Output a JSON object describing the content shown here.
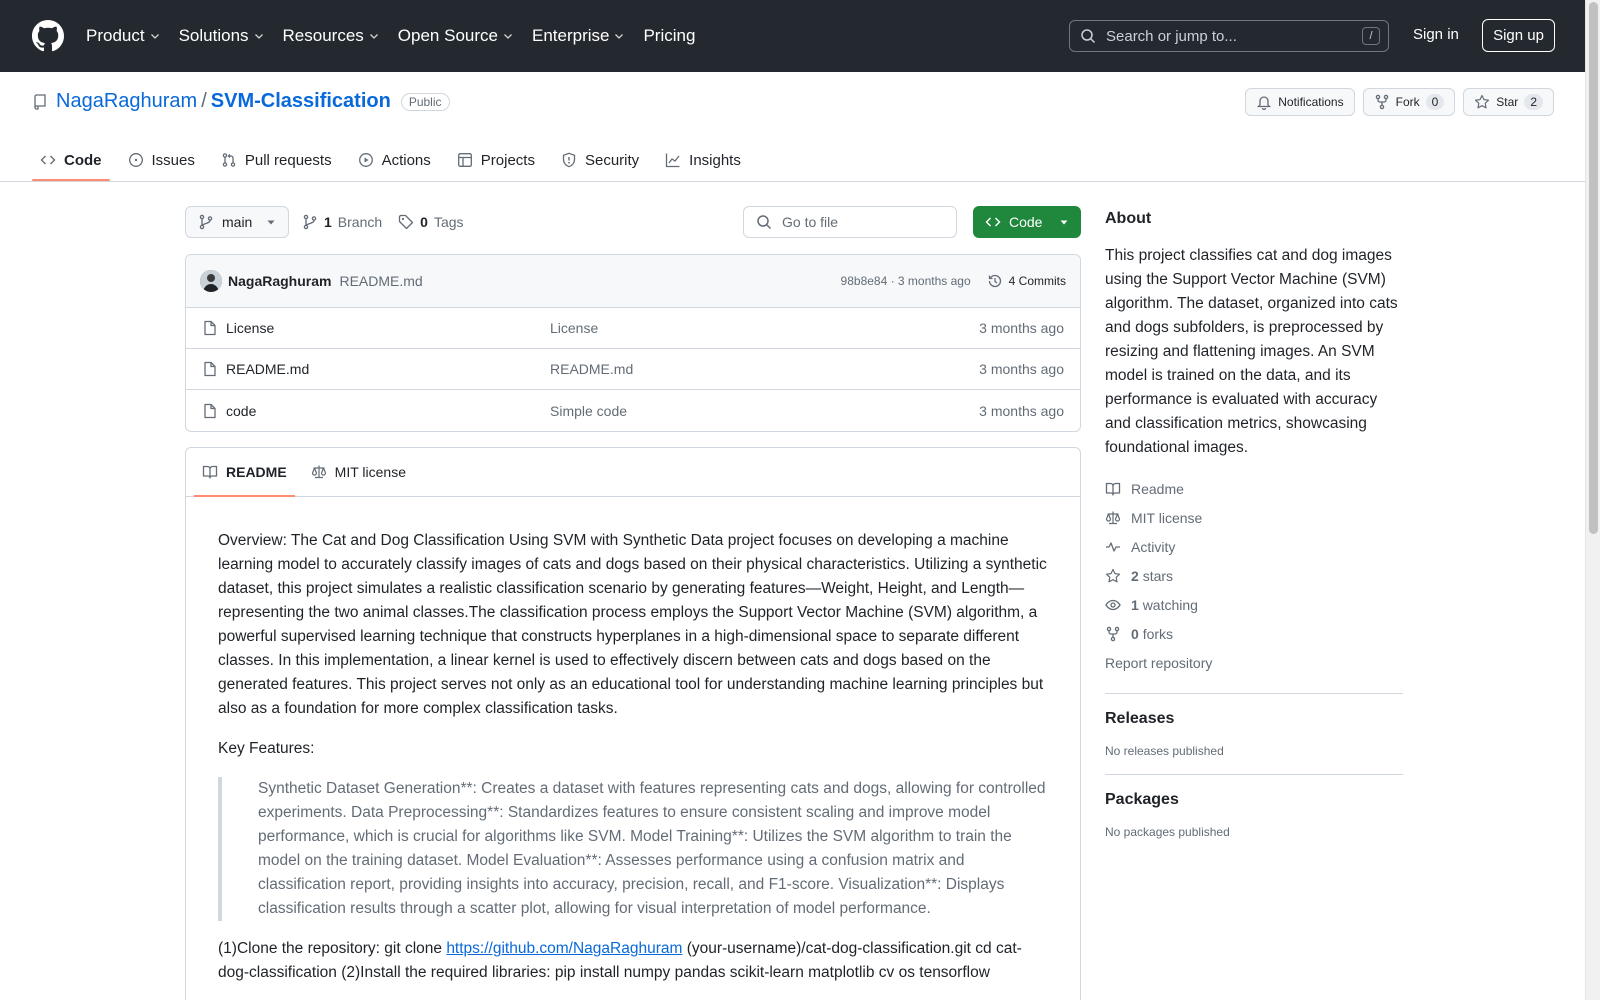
{
  "header": {
    "nav": [
      {
        "label": "Product",
        "dropdown": true
      },
      {
        "label": "Solutions",
        "dropdown": true
      },
      {
        "label": "Resources",
        "dropdown": true
      },
      {
        "label": "Open Source",
        "dropdown": true
      },
      {
        "label": "Enterprise",
        "dropdown": true
      },
      {
        "label": "Pricing",
        "dropdown": false
      }
    ],
    "search_placeholder": "Search or jump to...",
    "search_key": "/",
    "sign_in": "Sign in",
    "sign_up": "Sign up"
  },
  "repo": {
    "owner": "NagaRaghuram",
    "separator": "/",
    "name": "SVM-Classification",
    "visibility": "Public",
    "notifications_label": "Notifications",
    "fork_label": "Fork",
    "fork_count": "0",
    "star_label": "Star",
    "star_count": "2"
  },
  "tabs": {
    "code": "Code",
    "issues": "Issues",
    "pulls": "Pull requests",
    "actions": "Actions",
    "projects": "Projects",
    "security": "Security",
    "insights": "Insights"
  },
  "filenav": {
    "branch": "main",
    "branch_count": "1",
    "branch_label": "Branch",
    "tag_count": "0",
    "tag_label": "Tags",
    "goto_placeholder": "Go to file",
    "code_button": "Code"
  },
  "commit": {
    "author": "NagaRaghuram",
    "message": "README.md",
    "meta": "98b8e84 · 3 months ago",
    "commits": "4 Commits"
  },
  "files": [
    {
      "name": "License",
      "message": "License",
      "time": "3 months ago"
    },
    {
      "name": "README.md",
      "message": "README.md",
      "time": "3 months ago"
    },
    {
      "name": "code",
      "message": "Simple code",
      "time": "3 months ago"
    }
  ],
  "readme": {
    "tab_readme": "README",
    "tab_license": "MIT license",
    "overview": "Overview: The Cat and Dog Classification Using SVM with Synthetic Data project focuses on developing a machine learning model to accurately classify images of cats and dogs based on their physical characteristics. Utilizing a synthetic dataset, this project simulates a realistic classification scenario by generating features—Weight, Height, and Length—representing the two animal classes.The classification process employs the Support Vector Machine (SVM) algorithm, a powerful supervised learning technique that constructs hyperplanes in a high-dimensional space to separate different classes. In this implementation, a linear kernel is used to effectively discern between cats and dogs based on the generated features. This project serves not only as an educational tool for understanding machine learning principles but also as a foundation for more complex classification tasks.",
    "key_features_heading": "Key Features:",
    "key_features": "Synthetic Dataset Generation**: Creates a dataset with features representing cats and dogs, allowing for controlled experiments. Data Preprocessing**: Standardizes features to ensure consistent scaling and improve model performance, which is crucial for algorithms like SVM. Model Training**: Utilizes the SVM algorithm to train the model on the training dataset. Model Evaluation**: Assesses performance using a confusion matrix and classification report, providing insights into accuracy, precision, recall, and F1-score. Visualization**: Displays classification results through a scatter plot, allowing for visual interpretation of model performance.",
    "clone_prefix": "(1)Clone the repository: git clone ",
    "clone_link": "https://github.com/NagaRaghuram",
    "clone_suffix": " (your-username)/cat-dog-classification.git cd cat-dog-classification (2)Install the required libraries: pip install numpy pandas scikit-learn matplotlib cv os tensorflow"
  },
  "about": {
    "heading": "About",
    "description": "This project classifies cat and dog images using the Support Vector Machine (SVM) algorithm. The dataset, organized into cats and dogs subfolders, is preprocessed by resizing and flattening images. An SVM model is trained on the data, and its performance is evaluated with accuracy and classification metrics, showcasing foundational images.",
    "readme": "Readme",
    "license": "MIT license",
    "activity": "Activity",
    "stars_count": "2",
    "stars_label": "stars",
    "watching_count": "1",
    "watching_label": "watching",
    "forks_count": "0",
    "forks_label": "forks",
    "report": "Report repository"
  },
  "releases": {
    "heading": "Releases",
    "empty": "No releases published"
  },
  "packages": {
    "heading": "Packages",
    "empty": "No packages published"
  },
  "colors": {
    "header_bg": "#24292f",
    "accent_link": "#0969da",
    "code_button": "#1f883d",
    "tab_underline": "#fd8c73"
  }
}
